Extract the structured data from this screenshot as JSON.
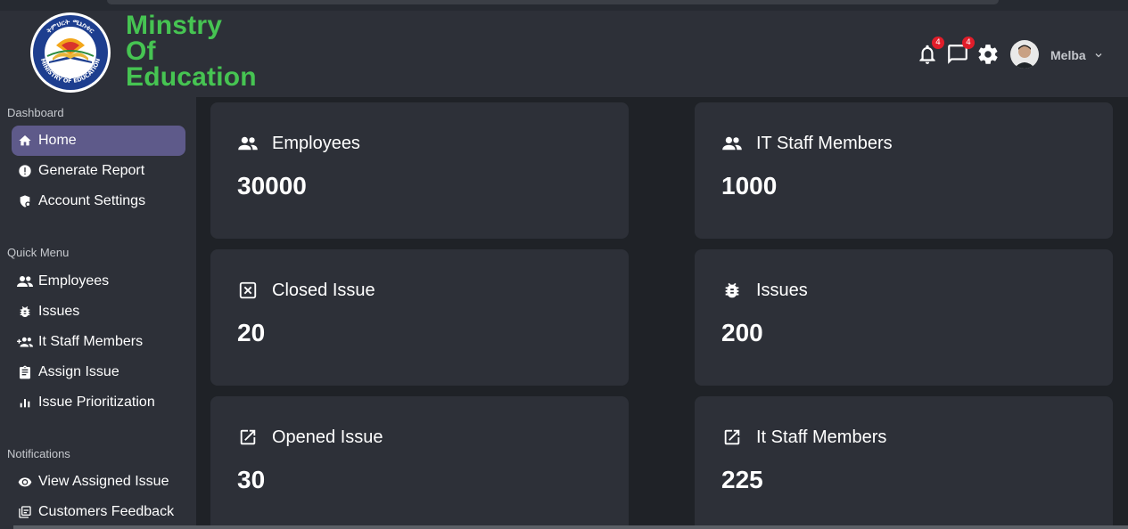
{
  "header": {
    "brand_lines": [
      "Minstry",
      "Of",
      "Education"
    ],
    "logo_text_top": "ትምህርት ሚኒስቴር",
    "logo_text_bottom": "MINISTRY OF EDUCATION",
    "notifications_count": "4",
    "messages_count": "4",
    "user_name": "Melba",
    "icons": [
      "bell-icon",
      "chat-icon",
      "gear-icon",
      "chevron-down-icon"
    ]
  },
  "sidebar": {
    "sections": [
      {
        "title": "Dashboard",
        "items": [
          {
            "label": "Home",
            "icon": "home-icon",
            "active": true
          },
          {
            "label": "Generate Report",
            "icon": "alert-circle-icon"
          },
          {
            "label": "Account Settings",
            "icon": "shield-gear-icon"
          }
        ]
      },
      {
        "title": "Quick Menu",
        "items": [
          {
            "label": "Employees",
            "icon": "people-icon"
          },
          {
            "label": "Issues",
            "icon": "bug-icon"
          },
          {
            "label": "It Staff Members",
            "icon": "group-add-icon"
          },
          {
            "label": "Assign Issue",
            "icon": "clipboard-icon"
          },
          {
            "label": "Issue Prioritization",
            "icon": "bar-chart-icon"
          }
        ]
      },
      {
        "title": "Notifications",
        "items": [
          {
            "label": "View Assigned Issue",
            "icon": "eye-icon"
          },
          {
            "label": "Customers Feedback",
            "icon": "library-icon"
          }
        ]
      }
    ]
  },
  "cards": [
    {
      "title": "Employees",
      "value": "30000",
      "icon": "people-icon"
    },
    {
      "title": "IT Staff Members",
      "value": "1000",
      "icon": "people-icon"
    },
    {
      "title": "Closed Issue",
      "value": "20",
      "icon": "close-box-icon"
    },
    {
      "title": "Issues",
      "value": "200",
      "icon": "bug-icon"
    },
    {
      "title": "Opened Issue",
      "value": "30",
      "icon": "open-in-new-icon"
    },
    {
      "title": "It Staff Members",
      "value": "225",
      "icon": "open-in-new-icon"
    }
  ],
  "colors": {
    "background": "#1f2227",
    "panel": "#2d3038",
    "brand_green": "#46c452",
    "active_nav": "#5e5a8a",
    "badge_red": "#e11d2a"
  }
}
